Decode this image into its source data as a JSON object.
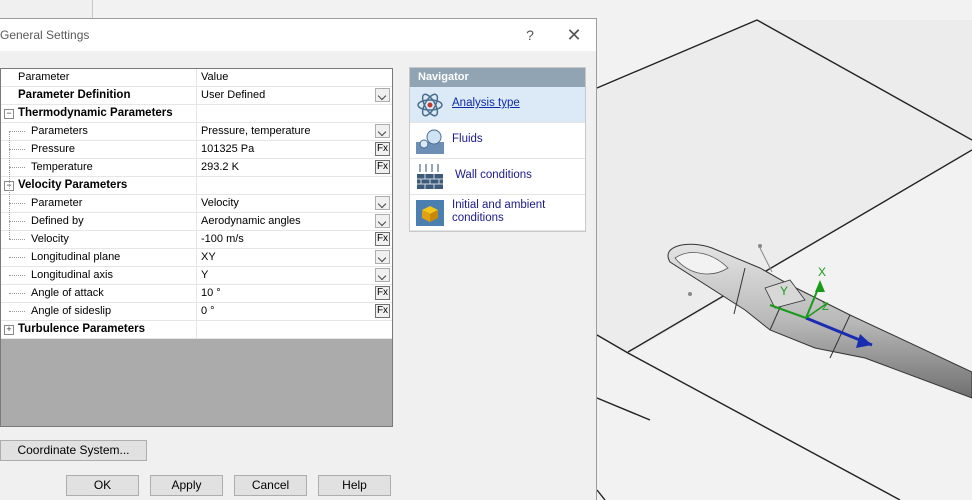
{
  "dialog": {
    "title": "General Settings",
    "help_glyph": "?",
    "close_glyph": "✕"
  },
  "grid": {
    "header": {
      "parameter": "Parameter",
      "value": "Value"
    },
    "rows": [
      {
        "label": "Parameter Definition",
        "value": "User Defined",
        "kind": "dropdown",
        "bold": true
      },
      {
        "label": "Thermodynamic Parameters",
        "value": "",
        "kind": "group",
        "expander": "−"
      },
      {
        "label": "Parameters",
        "value": "Pressure, temperature",
        "kind": "dropdown"
      },
      {
        "label": "Pressure",
        "value": "101325 Pa",
        "kind": "fx"
      },
      {
        "label": "Temperature",
        "value": "293.2 K",
        "kind": "fx"
      },
      {
        "label": "Velocity Parameters",
        "value": "",
        "kind": "group",
        "expander": "−"
      },
      {
        "label": "Parameter",
        "value": "Velocity",
        "kind": "dropdown"
      },
      {
        "label": "Defined by",
        "value": "Aerodynamic angles",
        "kind": "dropdown"
      },
      {
        "label": "Velocity",
        "value": "-100 m/s",
        "kind": "fx"
      },
      {
        "label": "Longitudinal plane",
        "value": "XY",
        "kind": "dropdown"
      },
      {
        "label": "Longitudinal axis",
        "value": "Y",
        "kind": "dropdown"
      },
      {
        "label": "Angle of attack",
        "value": "10 °",
        "kind": "fx"
      },
      {
        "label": "Angle of sideslip",
        "value": "0 °",
        "kind": "fx"
      },
      {
        "label": "Turbulence Parameters",
        "value": "",
        "kind": "group",
        "expander": "+"
      }
    ],
    "fx_label": "Fx"
  },
  "navigator": {
    "title": "Navigator",
    "items": [
      {
        "label": "Analysis type",
        "icon": "atom-icon",
        "selected": true
      },
      {
        "label": "Fluids",
        "icon": "fluid-drop-icon",
        "selected": false
      },
      {
        "label": "Wall conditions",
        "icon": "wall-icon",
        "selected": false
      },
      {
        "label": "Initial and ambient conditions",
        "icon": "cube-icon",
        "selected": false
      }
    ]
  },
  "buttons": {
    "coordinate_system": "Coordinate System...",
    "ok": "OK",
    "apply": "Apply",
    "cancel": "Cancel",
    "help": "Help"
  },
  "viewport": {
    "axis_x": "X",
    "axis_y": "Y",
    "axis_z": "Z"
  }
}
